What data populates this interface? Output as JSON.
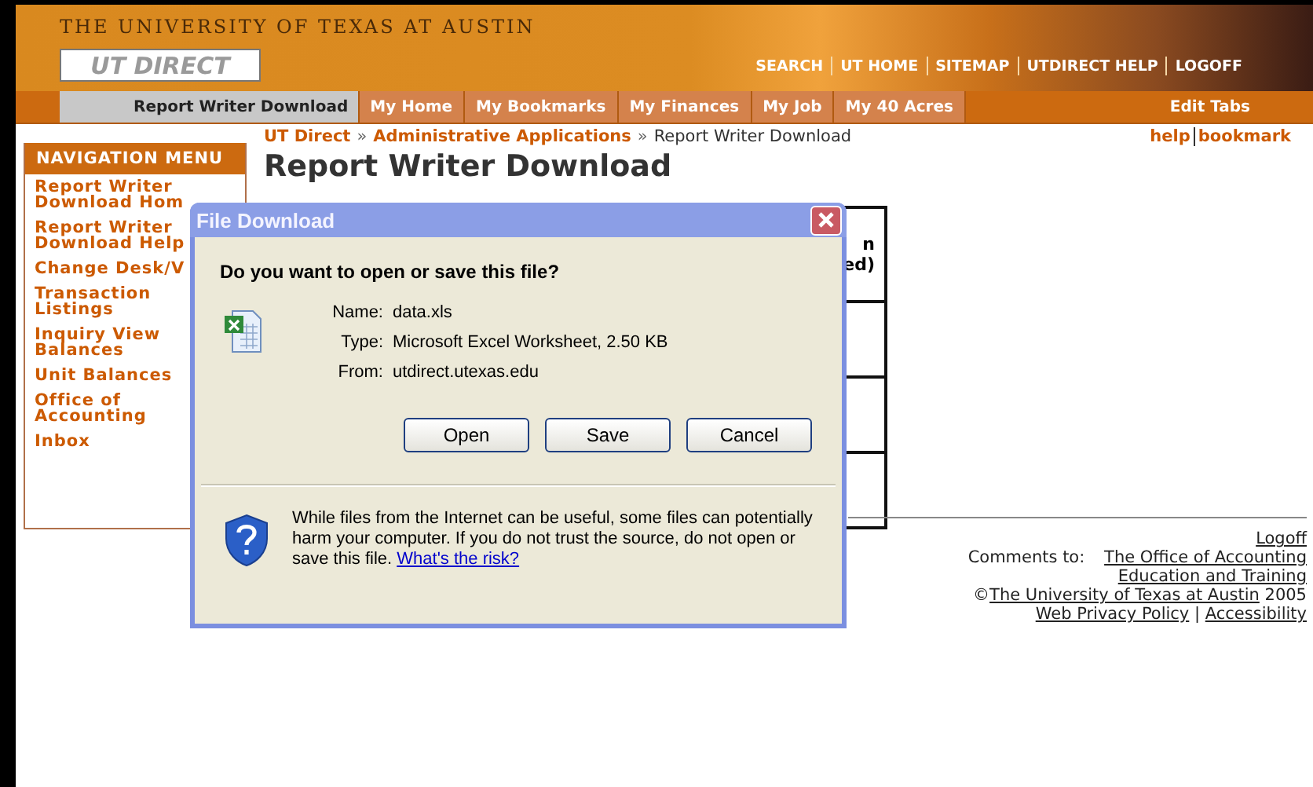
{
  "header": {
    "university": "THE UNIVERSITY OF TEXAS AT AUSTIN",
    "logo": "UT DIRECT",
    "links": [
      "SEARCH",
      "UT HOME",
      "SITEMAP",
      "UTDIRECT HELP",
      "LOGOFF"
    ]
  },
  "tabs": [
    {
      "label": "Report Writer Download",
      "selected": true
    },
    {
      "label": "My Home",
      "selected": false
    },
    {
      "label": "My Bookmarks",
      "selected": false
    },
    {
      "label": "My Finances",
      "selected": false
    },
    {
      "label": "My Job",
      "selected": false
    },
    {
      "label": "My 40 Acres",
      "selected": false
    }
  ],
  "edit_tabs": "Edit Tabs",
  "breadcrumb": [
    {
      "label": "UT Direct",
      "link": true
    },
    {
      "label": "Administrative Applications",
      "link": true
    },
    {
      "label": "Report Writer Download",
      "link": false
    }
  ],
  "breadcrumb_separator": "»",
  "top_links": [
    "help",
    "bookmark"
  ],
  "page_title": "Report Writer Download",
  "sidebar": {
    "title": "NAVIGATION MENU",
    "items": [
      "Report Writer Download Hom",
      "Report Writer Download Help",
      "Change Desk/V",
      "Transaction Listings",
      "Inquiry View Balances",
      "Unit Balances",
      "Office of Accounting",
      "Inbox"
    ]
  },
  "table": {
    "header_lines": [
      "n",
      "ed)"
    ]
  },
  "footer": {
    "logoff": "Logoff",
    "comments_label": "Comments to:",
    "comments_link": "The Office of Accounting Education and Training",
    "copyright_mark": "©",
    "copyright_link": "The University of Texas at Austin",
    "year": "2005",
    "links": [
      "Web Privacy Policy",
      "Accessibility"
    ],
    "separator": "|"
  },
  "dialog": {
    "title": "File Download",
    "question": "Do you want to open or save this file?",
    "fields": [
      {
        "label": "Name:",
        "value": "data.xls"
      },
      {
        "label": "Type:",
        "value": "Microsoft Excel Worksheet, 2.50 KB"
      },
      {
        "label": "From:",
        "value": "utdirect.utexas.edu"
      }
    ],
    "buttons": [
      "Open",
      "Save",
      "Cancel"
    ],
    "warning": "While files from the Internet can be useful, some files can potentially harm your computer. If you do not trust the source, do not open or save this file.",
    "risk_link": "What's the risk?"
  }
}
